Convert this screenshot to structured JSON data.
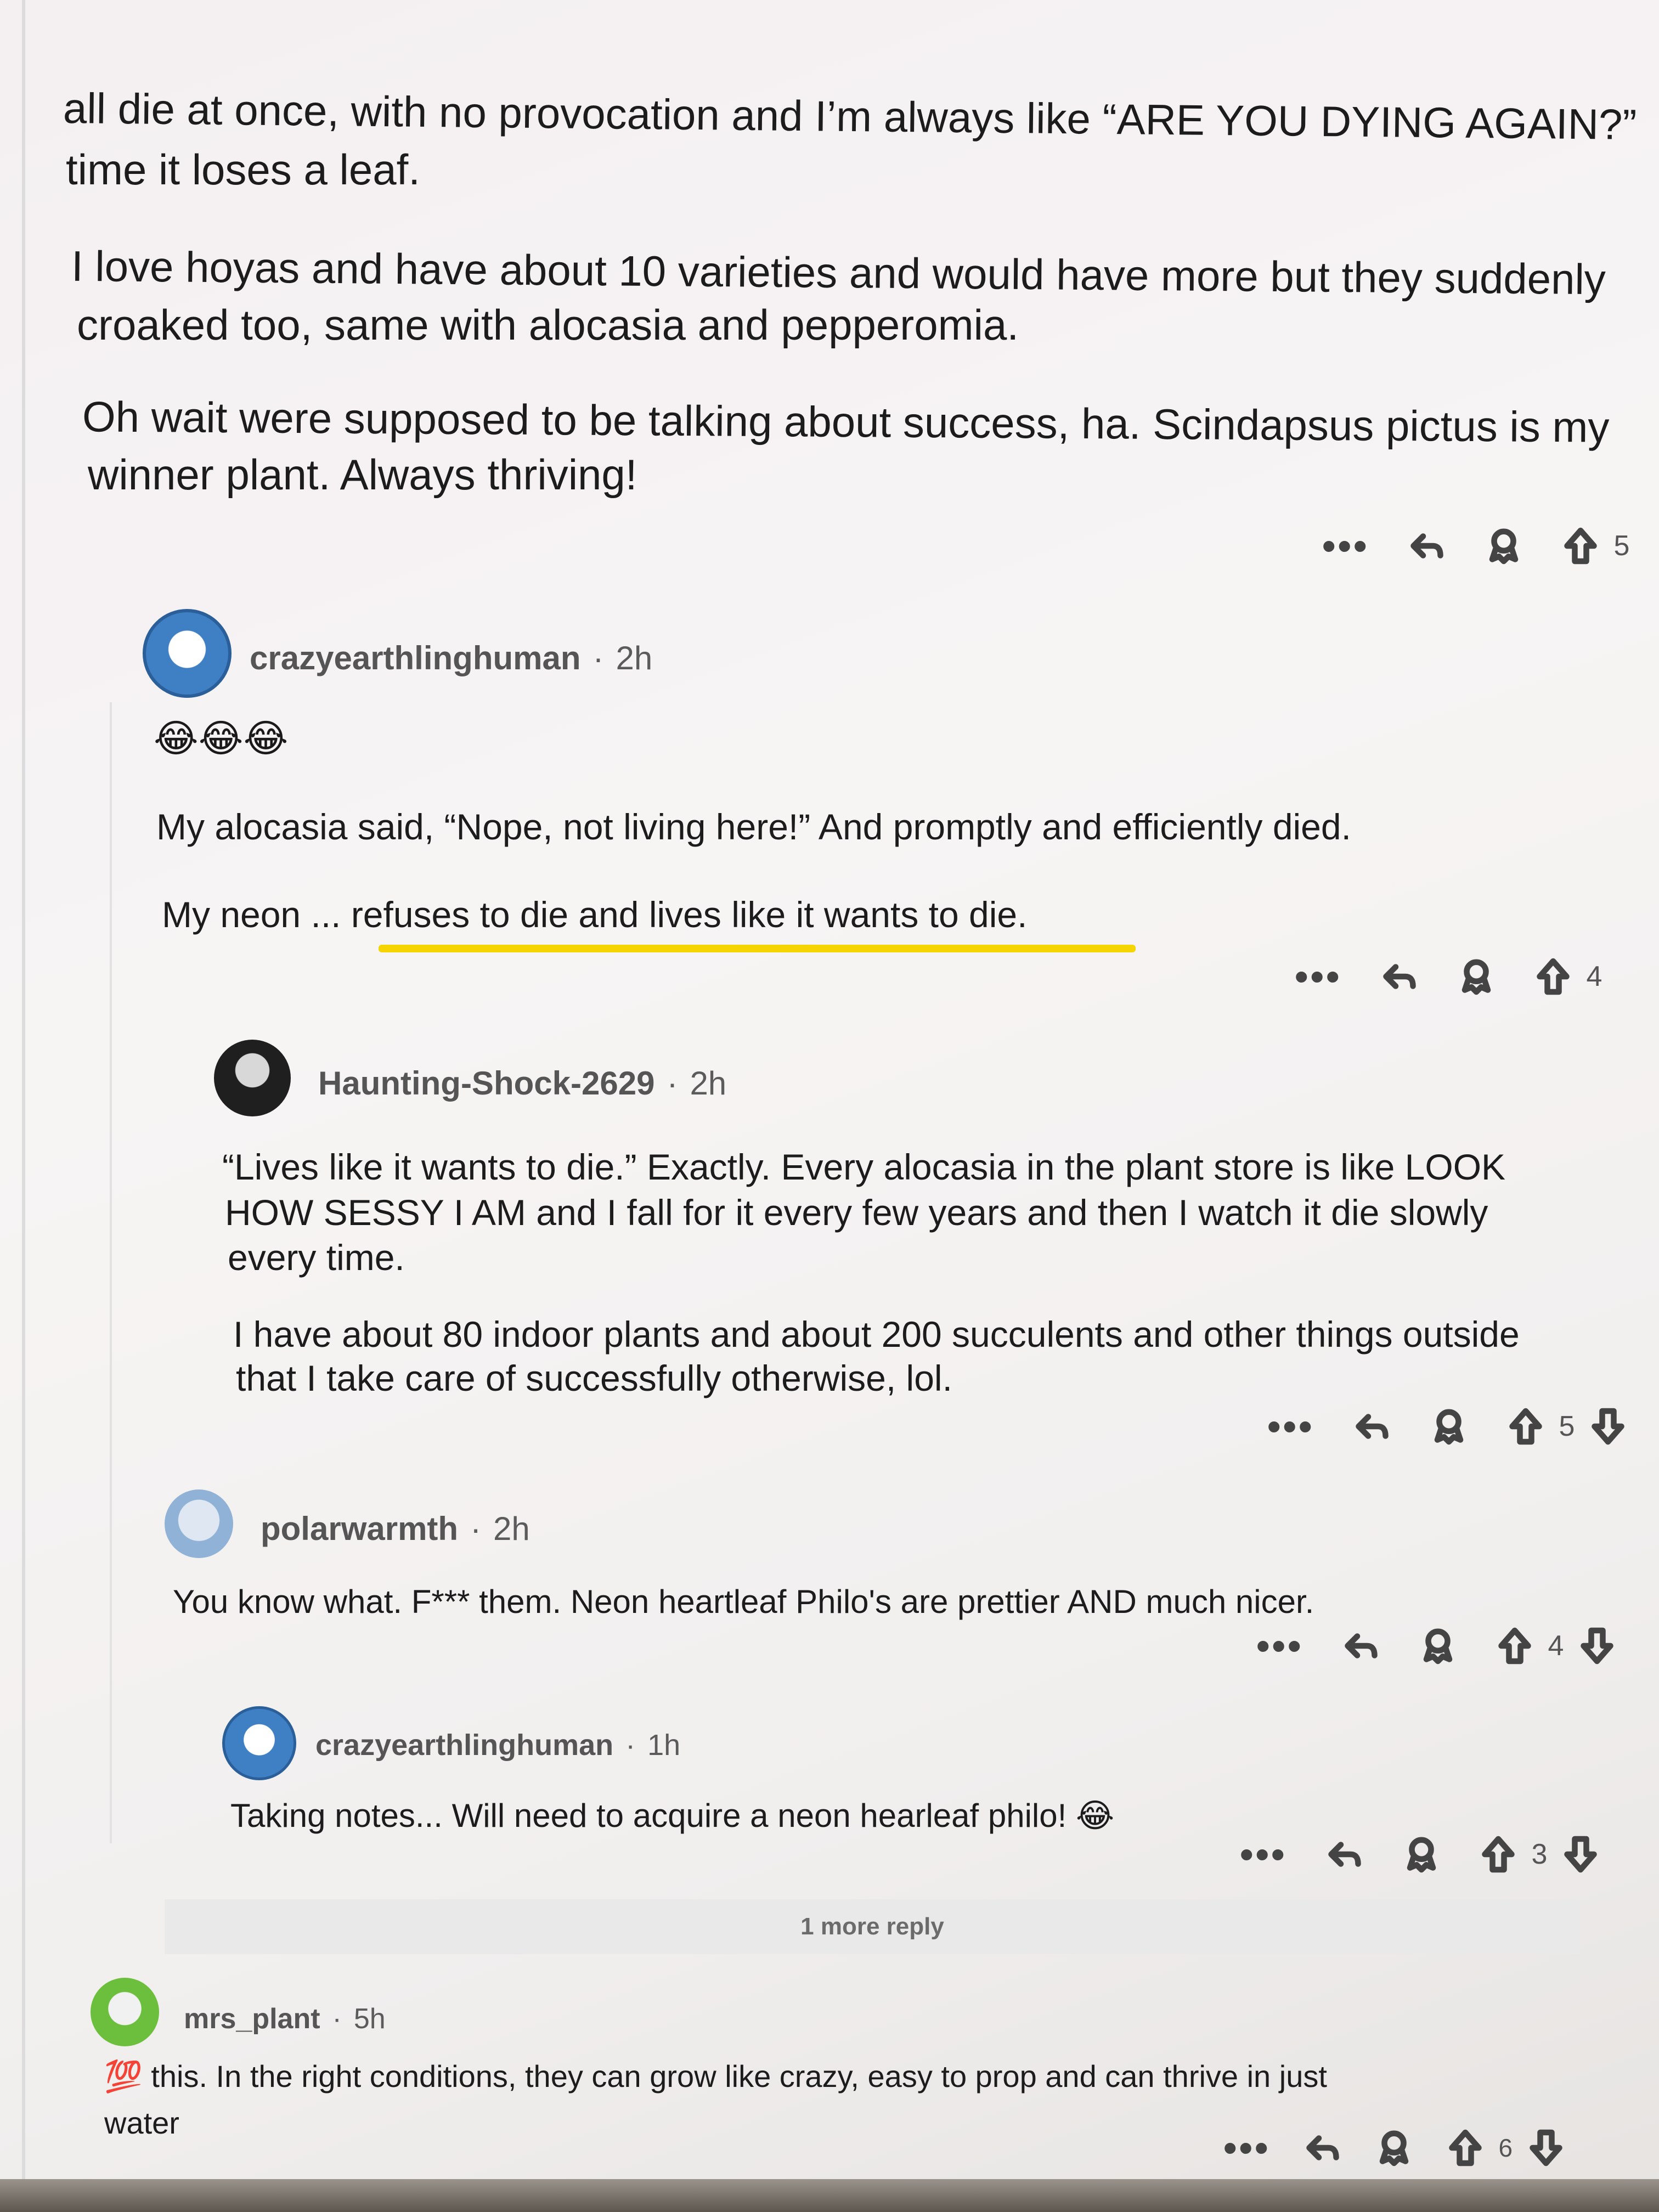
{
  "top_comment": {
    "lines": [
      "all die at once, with no provocation and I’m always like “ARE YOU DYING AGAIN?”",
      "time it loses a leaf."
    ],
    "para2": [
      "I love hoyas and have about 10 varieties and would have more but they suddenly",
      "croaked too, same with alocasia and pepperomia."
    ],
    "para3": [
      "Oh wait were supposed to be talking about success, ha. Scindapsus pictus is my",
      "winner plant. Always thriving!"
    ],
    "vote_count": "5"
  },
  "comments": [
    {
      "user": "crazyearthlinghuman",
      "time": "2h",
      "emoji": "😂😂😂",
      "text1": "My alocasia said, “Nope, not living here!” And promptly and efficiently died.",
      "text2_a": "My neon ... ",
      "text2_b": "refuses to die and lives like it wants to die.",
      "votes": "4"
    },
    {
      "user": "Haunting-Shock-2629",
      "time": "2h",
      "p1": [
        "“Lives like it wants to die.” Exactly. Every alocasia in the plant store is like LOOK",
        "HOW SESSY I AM and I fall for it every few years and then I watch it die slowly",
        "every time."
      ],
      "p2": [
        "I have about 80 indoor plants and about 200 succulents and other things outside",
        "that I take care of successfully otherwise, lol."
      ],
      "votes": "5"
    },
    {
      "user": "polarwarmth",
      "time": "2h",
      "text": "You know what. F*** them. Neon heartleaf Philo's are prettier AND much nicer.",
      "votes": "4"
    },
    {
      "user": "crazyearthlinghuman",
      "time": "1h",
      "text": "Taking notes... Will need to acquire a neon hearleaf philo! 😂",
      "votes": "3"
    },
    {
      "user": "mrs_plant",
      "time": "5h",
      "badge": "💯",
      "text1": " this. In the right conditions, they can grow like crazy, easy to prop and can thrive in just",
      "text2": "water",
      "votes": "6"
    }
  ],
  "more_replies": "1 more reply",
  "separator": "·",
  "dots": "•••",
  "colors": {
    "highlight": "#f5d400",
    "avatar_blue": "#3f7fc4",
    "avatar_green": "#6cbf3c"
  }
}
